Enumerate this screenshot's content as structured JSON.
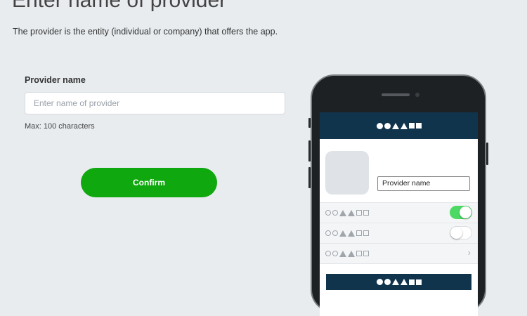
{
  "page": {
    "title": "Enter name of provider",
    "description": "The provider is the entity (individual or company) that offers the app."
  },
  "form": {
    "label": "Provider name",
    "placeholder": "Enter name of provider",
    "value": "",
    "hint": "Max: 100 characters",
    "confirm_label": "Confirm"
  },
  "preview": {
    "provider_name": "Provider name",
    "rows": [
      {
        "type": "toggle",
        "state": "on"
      },
      {
        "type": "toggle",
        "state": "off"
      },
      {
        "type": "chevron",
        "icon": "chevron-right-icon"
      }
    ]
  },
  "colors": {
    "background": "#e8ecef",
    "confirm": "#0fa80f",
    "phone_header": "#11344d",
    "toggle_on": "#4cd964"
  }
}
